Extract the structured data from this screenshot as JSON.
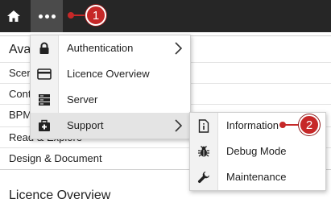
{
  "topbar": {
    "home_icon": "home-icon",
    "more_icon": "ellipsis-icon"
  },
  "callouts": [
    "1",
    "2"
  ],
  "background": {
    "panel_title": "Ava",
    "rows": [
      "Scer",
      "Cont",
      "BPM",
      "Read & Explore",
      "Design & Document"
    ],
    "section_title": "Licence Overview"
  },
  "menu": {
    "items": [
      {
        "label": "Authentication",
        "icon": "lock-icon",
        "has_submenu": true
      },
      {
        "label": "Licence Overview",
        "icon": "card-icon",
        "has_submenu": false
      },
      {
        "label": "Server",
        "icon": "server-icon",
        "has_submenu": false
      },
      {
        "label": "Support",
        "icon": "medkit-icon",
        "has_submenu": true
      }
    ]
  },
  "submenu": {
    "items": [
      {
        "label": "Information",
        "icon": "info-file-icon"
      },
      {
        "label": "Debug Mode",
        "icon": "bug-icon"
      },
      {
        "label": "Maintenance",
        "icon": "wrench-icon"
      }
    ]
  },
  "colors": {
    "topbar": "#262626",
    "accent_red": "#c62828",
    "highlight": "#e4e4e4"
  }
}
